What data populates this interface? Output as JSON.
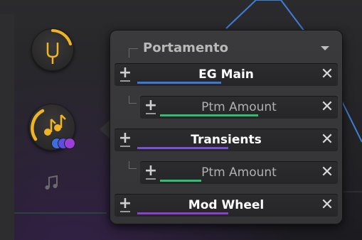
{
  "panel": {
    "title": "Portamento",
    "rows": [
      {
        "label": "EG Main",
        "type": "main",
        "bar_color": "#3b78d8",
        "bar_level": 0.5
      },
      {
        "label": "Ptm Amount",
        "type": "sub",
        "bar_color": "#2fbf73",
        "bar_level": 0.6
      },
      {
        "label": "Transients",
        "type": "main",
        "bar_color": "#7b4fd6",
        "bar_level": 0.5
      },
      {
        "label": "Ptm Amount",
        "type": "sub",
        "bar_color": "#2fbf73",
        "bar_level": 0.2
      },
      {
        "label": "Mod Wheel",
        "type": "main",
        "bar_color": "#8a3fd0",
        "bar_level": 0.5
      }
    ],
    "add_icon": "plus-icon",
    "remove_icon": "close-icon",
    "dropdown_icon": "chevron-down-icon"
  },
  "colors": {
    "accent": "#f0b323",
    "dot_blue": "#3b6fe0",
    "dot_indigo": "#5a4fe0",
    "dot_purple": "#9a3fd8"
  },
  "icons": {
    "tuning": "tuning-fork-icon",
    "portamento": "music-note-icon",
    "note": "music-note-icon"
  }
}
